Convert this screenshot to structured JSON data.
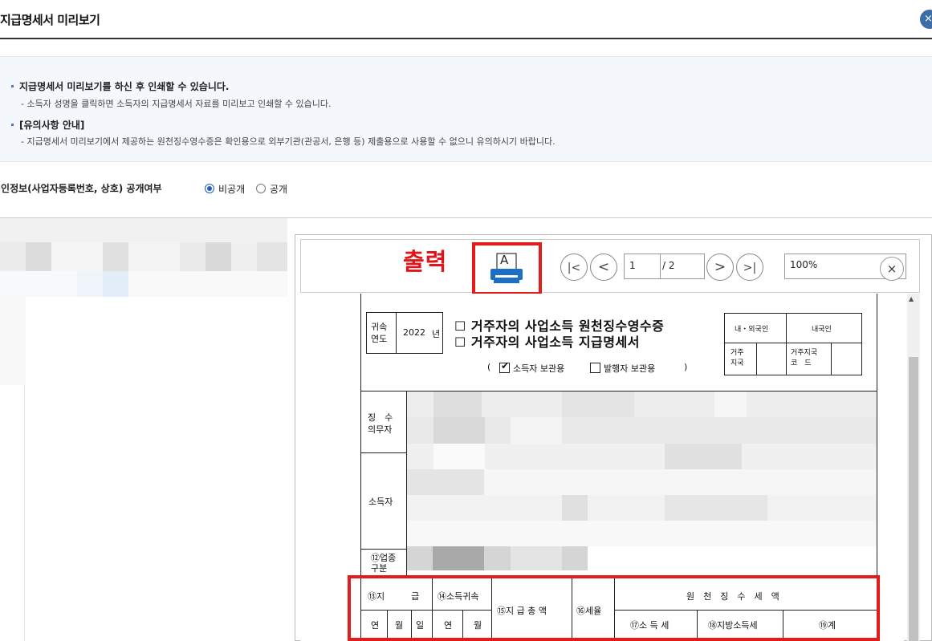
{
  "dialog": {
    "title": "지급명세서 미리보기",
    "close_label": "×"
  },
  "info": {
    "bullet1": "지급명세서 미리보기를 하신 후 인쇄할 수 있습니다.",
    "sub1": "- 소득자 성명을 클릭하면 소득자의 지급명세서 자료를 미리보고 인쇄할 수 있습니다.",
    "bullet2": "[유의사항 안내]",
    "sub2": "- 지급명세서 미리보기에서 제공하는 원천징수영수증은 확인용으로 외부기관(관공서, 은행 등) 제출용으로 사용할 수 없으니 유의하시기 바랍니다."
  },
  "privacy": {
    "label": "개인정보(사업자등록번호, 상호) 공개여부",
    "options": [
      {
        "label": "비공개",
        "selected": true
      },
      {
        "label": "공개",
        "selected": false
      }
    ]
  },
  "toolbar": {
    "print_annotation": "출력",
    "print_icon_letter": "A",
    "first_label": "|<",
    "prev_label": "<",
    "page_value": "1",
    "page_total": "/ 2",
    "next_label": ">",
    "last_label": ">|",
    "zoom_value": "100%",
    "zoom_close": "×"
  },
  "form": {
    "year_label": "귀속\n연도",
    "year_value": "2022",
    "year_unit": "년",
    "title1": "☐ 거주자의 사업소득 원천징수영수증",
    "title2": "☐ 거주자의 사업소득 지급명세서",
    "copy_open": "(",
    "copy_for_earner": "소득자 보관용",
    "copy_for_payer": "발행자 보관용",
    "copy_close": ")",
    "resident_label": "내・외국인",
    "resident_value": "내국인",
    "country_label": "거주\n지국",
    "country_code_label": "거주지국\n코　드",
    "withholder_label": "징　수\n의무자",
    "earner_label": "소득자",
    "biz_type_label": "⑫업종\n구분",
    "col_pay_date": "⑬지　　　급",
    "col_income_year": "⑭소득귀속",
    "col_total_pay": "⑮지 급 총 액",
    "col_tax_rate": "⑯세율",
    "col_withheld": "원　천　징　수　세　액",
    "sub_year": "연",
    "sub_month": "월",
    "sub_day": "일",
    "sub_income_tax": "⑰소 득 세",
    "sub_local_tax": "⑱지방소득세",
    "sub_total": "⑲계"
  },
  "colors": {
    "annotation_red": "#e41b1b",
    "accent_blue": "#1a5fc9",
    "print_icon_blue": "#1d6fc6"
  }
}
